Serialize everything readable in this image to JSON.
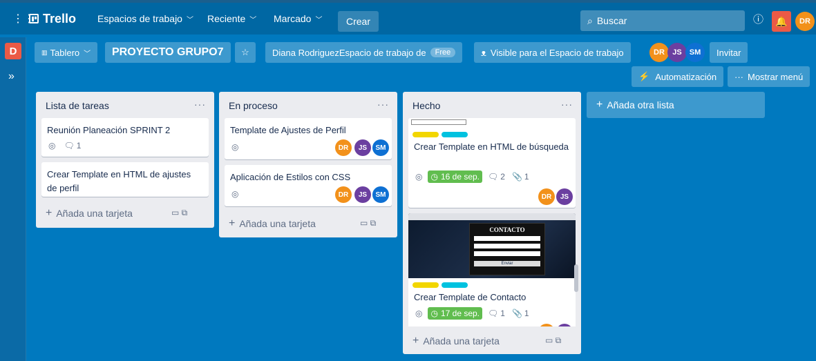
{
  "topbar": {
    "apps_icon": "grid-icon",
    "logo": "Trello",
    "workspaces": "Espacios de trabajo",
    "recent": "Reciente",
    "starred": "Marcado",
    "create": "Crear",
    "search_placeholder": "Buscar",
    "user_initials": "DR"
  },
  "boardbar": {
    "workspace_initial": "D",
    "view": "Tablero",
    "board_name": "PROYECTO GRUPO7",
    "workspace": "Diana RodriguezEspacio de trabajo de",
    "plan_badge": "Free",
    "visibility": "Visible para el Espacio de trabajo",
    "members": [
      "DR",
      "JS",
      "SM"
    ],
    "invite": "Invitar",
    "automation": "Automatización",
    "show_menu": "Mostrar menú"
  },
  "colors": {
    "dr": "#f2911b",
    "js": "#6b3fa0",
    "sm": "#0e70d3",
    "green": "#61bd4f",
    "yellow": "#f2d600",
    "sky": "#00c2e0"
  },
  "lists": [
    {
      "title": "Lista de tareas",
      "menu": "···",
      "add_card": "Añada una tarjeta",
      "cards": [
        {
          "title": "Reunión Planeación SPRINT 2",
          "comments": "1"
        },
        {
          "title": "Crear Template en HTML de ajustes de perfil"
        }
      ]
    },
    {
      "title": "En proceso",
      "menu": "···",
      "add_card": "Añada una tarjeta",
      "cards": [
        {
          "title": "Template de Ajustes de Perfil"
        },
        {
          "title": "Aplicación de Estilos con CSS"
        }
      ]
    },
    {
      "title": "Hecho",
      "menu": "···",
      "add_card": "Añada una tarjeta",
      "cards": [
        {
          "title": "Crear Template en HTML de búsqueda",
          "due": "16 de sep.",
          "comments": "2",
          "attachments": "1"
        },
        {
          "title": "Crear Template de Contacto",
          "due": "17 de sep.",
          "comments": "1",
          "attachments": "1",
          "cover_heading": "CONTACTO",
          "cover_button": "Enviar"
        }
      ]
    }
  ],
  "add_list": "Añada otra lista"
}
